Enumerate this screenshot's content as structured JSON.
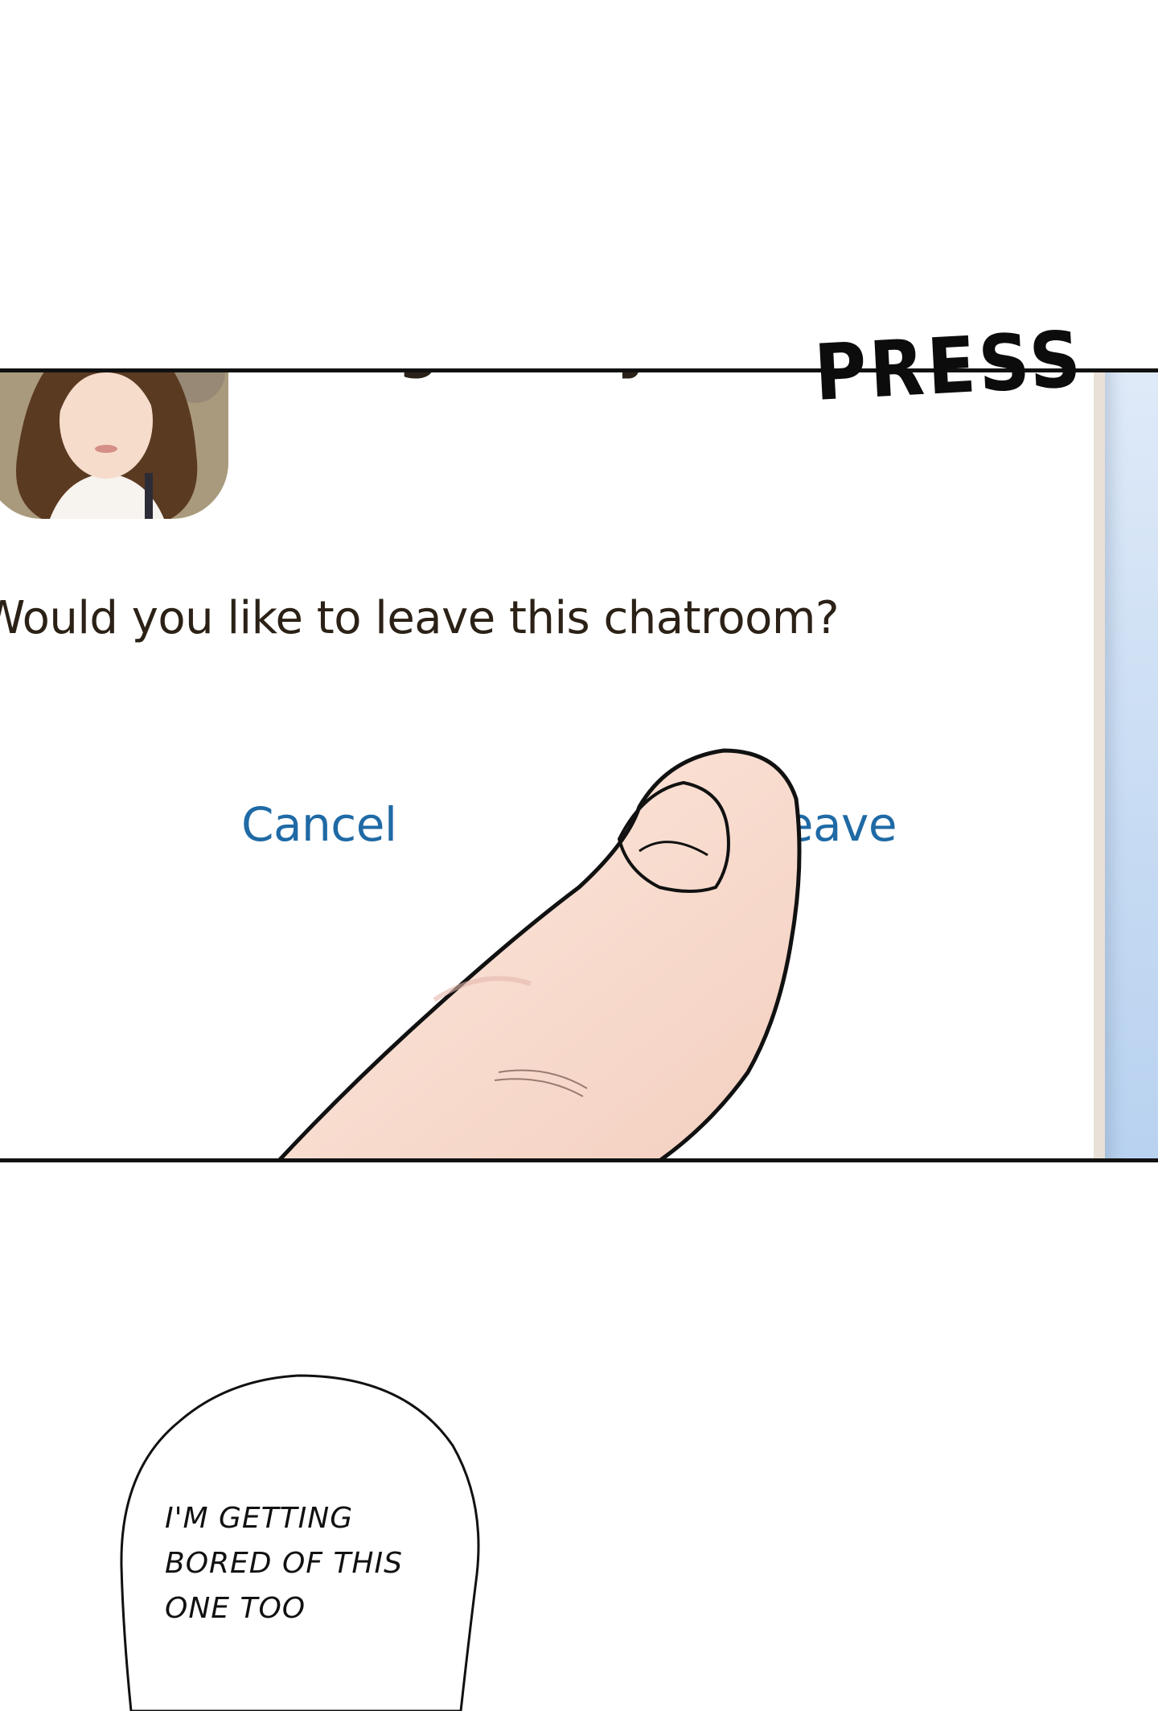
{
  "dialog": {
    "contact_name": "Song Chaeyeon",
    "question": "Would you like to leave this chatroom?",
    "cancel_label": "Cancel",
    "leave_label": "Leave",
    "accent_color": "#1f6aa5"
  },
  "sound_effect": "PRESS",
  "speech_bubble": {
    "lines": [
      "I'M GETTING",
      "BORED OF THIS",
      "ONE TOO"
    ]
  },
  "icons": {
    "avatar": "profile-photo-woman",
    "thumb": "pressing-thumb"
  }
}
